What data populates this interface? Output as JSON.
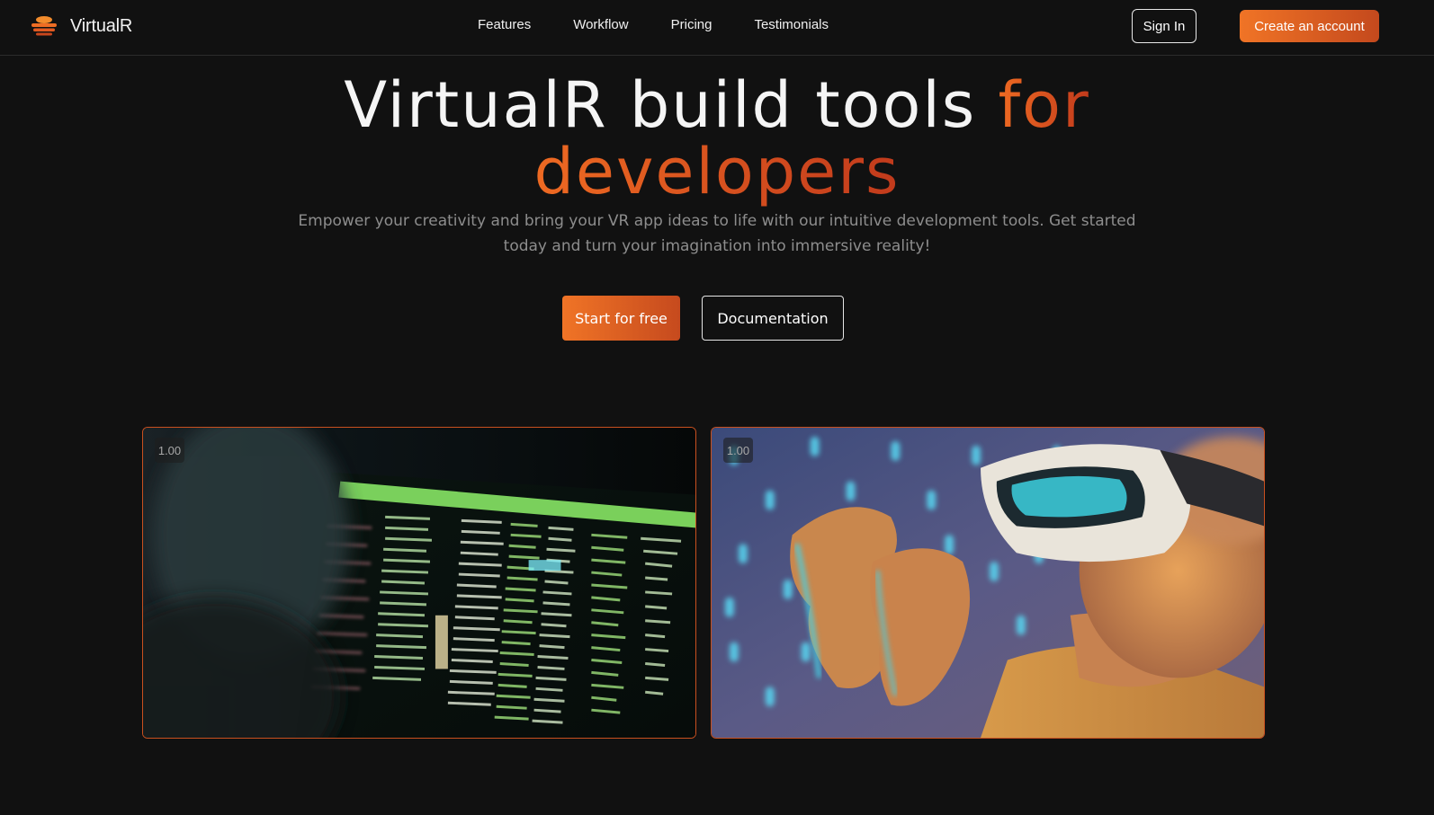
{
  "brand": {
    "name": "VirtualR",
    "logo_icon": "layered-disc-logo"
  },
  "nav": {
    "links": [
      "Features",
      "Workflow",
      "Pricing",
      "Testimonials"
    ],
    "sign_in_label": "Sign In",
    "create_account_label": "Create an account"
  },
  "hero": {
    "title_white": "VirtualR build tools ",
    "title_accent_1": "for",
    "title_accent_2": "developers",
    "subtitle": "Empower your creativity and bring your VR app ideas to life with our intuitive development tools. Get started today and turn your imagination into immersive reality!",
    "start_label": "Start for free",
    "docs_label": "Documentation"
  },
  "media": {
    "left": {
      "zoom": "1.00",
      "icon": "terminal-monitor-image"
    },
    "right": {
      "zoom": "1.00",
      "icon": "vr-headset-person-image"
    }
  },
  "colors": {
    "background": "#111111",
    "accent_start": "#f07426",
    "accent_end": "#c13a1c",
    "card_border": "#c9501f"
  }
}
